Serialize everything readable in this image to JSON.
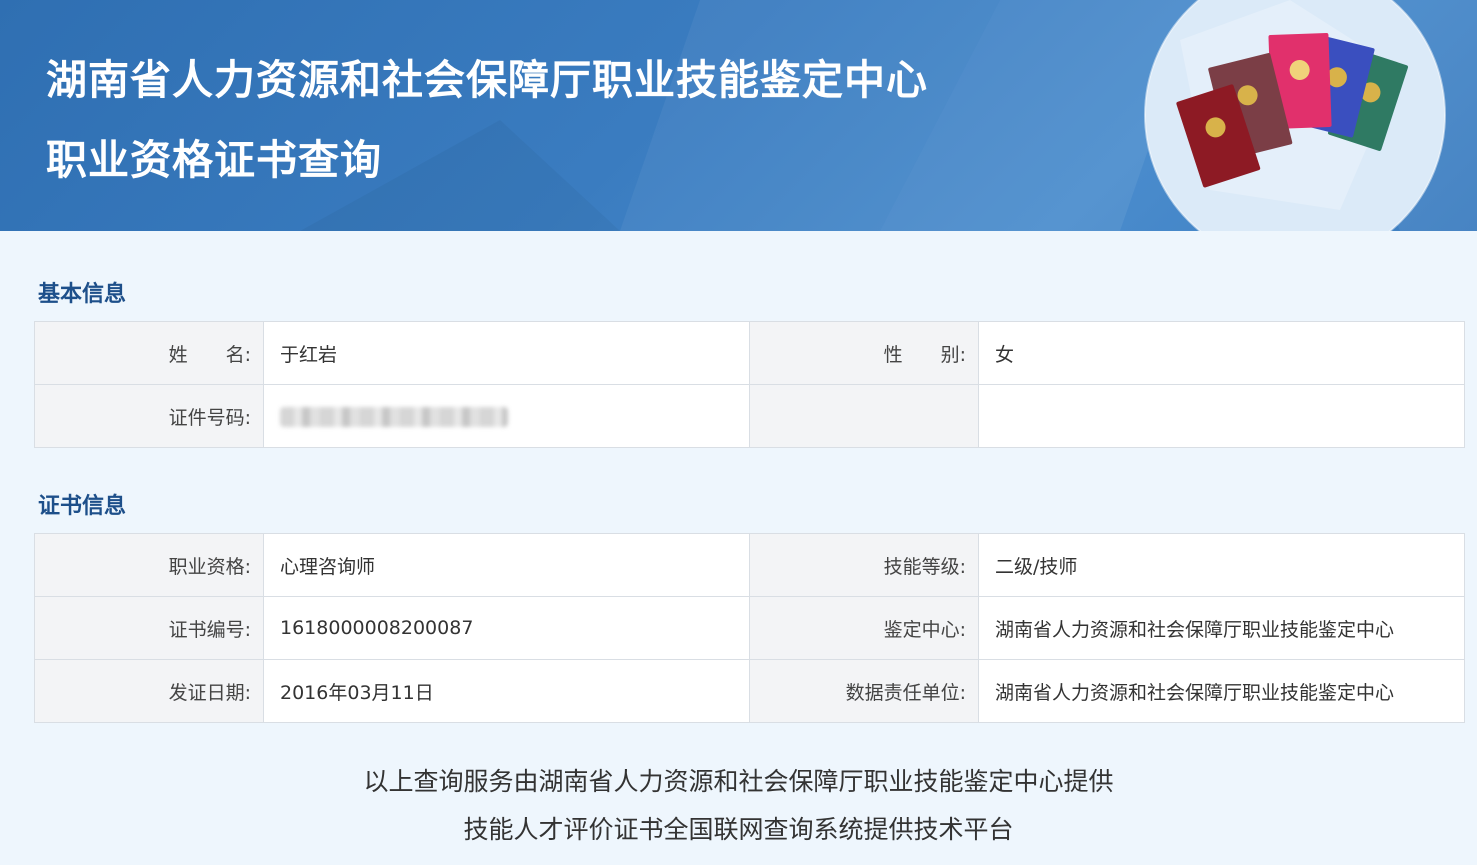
{
  "header": {
    "title": "湖南省人力资源和社会保障厅职业技能鉴定中心",
    "subtitle": "职业资格证书查询"
  },
  "basic_info": {
    "section_title": "基本信息",
    "name_label": "姓　　名:",
    "name_value": "于红岩",
    "gender_label": "性　　别:",
    "gender_value": "女",
    "id_label": "证件号码:"
  },
  "cert_info": {
    "section_title": "证书信息",
    "qualification_label": "职业资格:",
    "qualification_value": "心理咨询师",
    "level_label": "技能等级:",
    "level_value": "二级/技师",
    "cert_no_label": "证书编号:",
    "cert_no_value": "1618000008200087",
    "center_label": "鉴定中心:",
    "center_value": "湖南省人力资源和社会保障厅职业技能鉴定中心",
    "issue_date_label": "发证日期:",
    "issue_date_value": "2016年03月11日",
    "data_unit_label": "数据责任单位:",
    "data_unit_value": "湖南省人力资源和社会保障厅职业技能鉴定中心"
  },
  "footer": {
    "line1": "以上查询服务由湖南省人力资源和社会保障厅职业技能鉴定中心提供",
    "line2": "技能人才评价证书全国联网查询系统提供技术平台"
  },
  "colors": {
    "header_blue": "#3a7cc0",
    "section_title": "#1d4f8a",
    "page_bg": "#eef6fd"
  }
}
